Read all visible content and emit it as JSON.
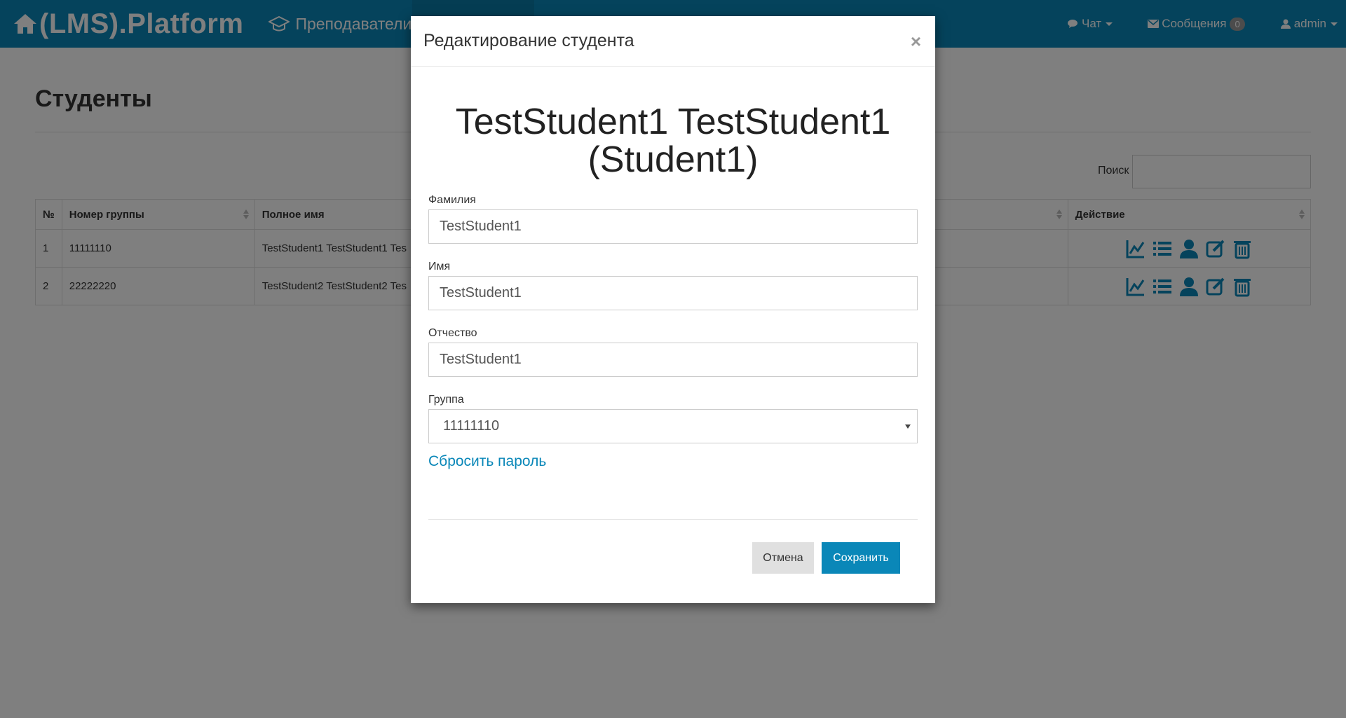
{
  "navbar": {
    "brand": "(LMS).Platform",
    "items": [
      {
        "label": "Преподаватели",
        "icon": "graduation-cap-icon"
      }
    ],
    "right": {
      "chat_label": "Чат",
      "messages_label": "Сообщения",
      "messages_count": "0",
      "user_label": "admin"
    },
    "accent_color": "#0a87b8"
  },
  "page": {
    "title": "Студенты",
    "search_label": "Поиск",
    "table": {
      "headers": [
        "№",
        "Номер группы",
        "Полное имя",
        "Действие"
      ],
      "rows": [
        {
          "num": "1",
          "group": "11111110",
          "name": "TestStudent1 TestStudent1 Tes"
        },
        {
          "num": "2",
          "group": "22222220",
          "name": "TestStudent2 TestStudent2 Tes"
        }
      ],
      "action_icons": [
        "chart-icon",
        "list-icon",
        "user-icon",
        "edit-icon",
        "trash-icon"
      ]
    }
  },
  "modal": {
    "title": "Редактирование студента",
    "close": "×",
    "student_name_line1": "TestStudent1 TestStudent1",
    "student_name_line2": "(Student1)",
    "fields": {
      "last_name_label": "Фамилия",
      "last_name_value": "TestStudent1",
      "first_name_label": "Имя",
      "first_name_value": "TestStudent1",
      "patronymic_label": "Отчество",
      "patronymic_value": "TestStudent1",
      "group_label": "Группа",
      "group_value": "11111110"
    },
    "reset_password": "Сбросить пароль",
    "cancel": "Отмена",
    "save": "Сохранить"
  }
}
